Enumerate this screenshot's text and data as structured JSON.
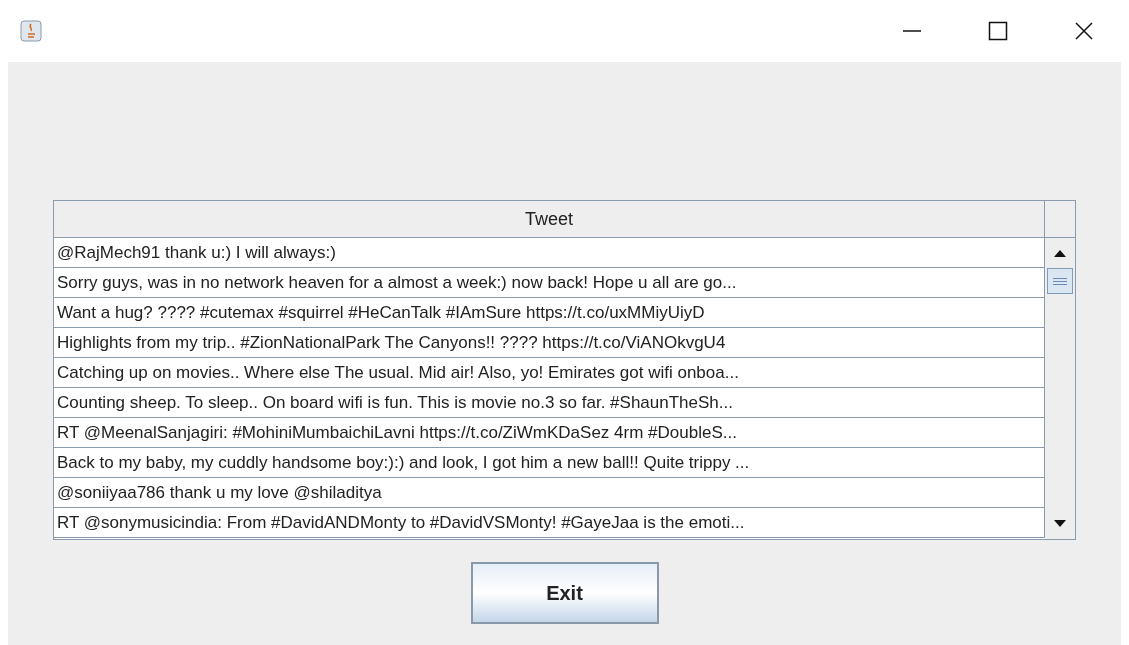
{
  "table": {
    "columns": [
      "Tweet"
    ],
    "rows": [
      "@RajMech91 thank u:) I will always:)",
      "Sorry guys, was in no network heaven for a almost a week:) now back! Hope u all are go...",
      "Want a hug? ???? #cutemax #squirrel #HeCanTalk #IAmSure https://t.co/uxMMiyUiyD",
      "Highlights from my trip.. #ZionNationalPark The Canyons!! ???? https://t.co/ViANOkvgU4",
      "Catching up on movies.. Where else The usual. Mid air! Also, yo! Emirates got wifi onboa...",
      "Counting sheep. To sleep.. On board wifi is fun. This is movie no.3 so far. #ShaunTheSh...",
      "RT @MeenalSanjagiri: #MohiniMumbaichiLavni https://t.co/ZiWmKDaSez 4rm #DoubleS...",
      "Back to my baby, my cuddly handsome boy:):) and look, I got him a new ball!! Quite trippy ...",
      "@soniiyaa786 thank u my love @shiladitya",
      "RT @sonymusicindia: From #DavidANDMonty to #DavidVSMonty! #GayeJaa is the emoti..."
    ]
  },
  "buttons": [
    "Exit"
  ]
}
